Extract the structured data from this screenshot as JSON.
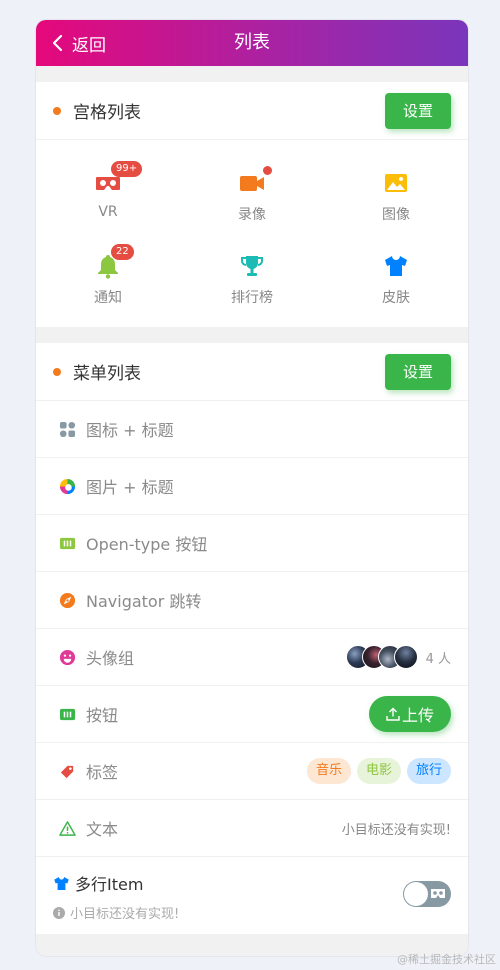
{
  "navbar": {
    "back_label": "返回",
    "title": "列表"
  },
  "grid_card": {
    "title": "宫格列表",
    "settings_label": "设置",
    "items": [
      {
        "label": "VR",
        "icon": "vr-icon",
        "color": "#e54d42",
        "badge": "99+"
      },
      {
        "label": "录像",
        "icon": "video-camera-icon",
        "color": "#f37b1d",
        "badge_dot": true
      },
      {
        "label": "图像",
        "icon": "picture-icon",
        "color": "#fbbd08"
      },
      {
        "label": "通知",
        "icon": "bell-icon",
        "color": "#8dc63f",
        "badge": "22"
      },
      {
        "label": "排行榜",
        "icon": "trophy-icon",
        "color": "#1cbbb4"
      },
      {
        "label": "皮肤",
        "icon": "shirt-icon",
        "color": "#0081ff"
      }
    ]
  },
  "menu_card": {
    "title": "菜单列表",
    "settings_label": "设置",
    "rows": [
      {
        "label": "图标 + 标题",
        "icon": "grid-icon",
        "color": "#8799a3"
      },
      {
        "label": "图片 + 标题",
        "icon": "colorful-logo-icon"
      },
      {
        "label": "Open-type 按钮",
        "icon": "button-icon",
        "color": "#8dc63f"
      },
      {
        "label": "Navigator 跳转",
        "icon": "discover-icon",
        "color": "#f37b1d"
      },
      {
        "label": "头像组",
        "icon": "emoji-icon",
        "color": "#e03997",
        "avatar_count": "4 人"
      },
      {
        "label": "按钮",
        "icon": "button-icon",
        "color": "#39b54a",
        "upload_label": "上传"
      },
      {
        "label": "标签",
        "icon": "tag-icon",
        "color": "#e54d42",
        "tags": [
          "音乐",
          "电影",
          "旅行"
        ]
      },
      {
        "label": "文本",
        "icon": "warning-icon",
        "color": "#39b54a",
        "text": "小目标还没有实现!"
      }
    ],
    "multi": {
      "title": "多行Item",
      "icon": "shirt-icon",
      "subtitle": "小目标还没有实现!",
      "switch_on": false
    }
  },
  "watermark": "@稀土掘金技术社区"
}
